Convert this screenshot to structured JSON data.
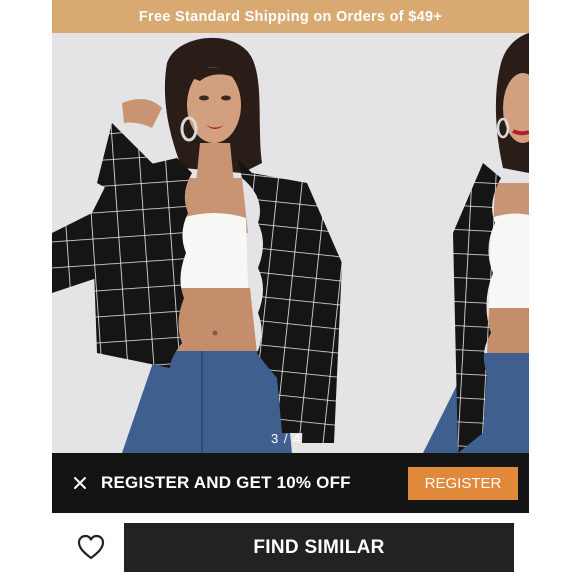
{
  "promo": {
    "text": "Free Standard Shipping on Orders of $49+"
  },
  "gallery": {
    "indicator": "3 / 4",
    "colors": {
      "backdrop": "#e4e4e6",
      "jacket": "#151515",
      "grid": "#f2f2f2",
      "denim": "#3f5f8f",
      "top": "#f7f7f5",
      "skin": "#c99473",
      "hair": "#2a1d18"
    }
  },
  "register_bar": {
    "close_icon": "close-icon",
    "text": "REGISTER AND GET 10% OFF",
    "button_label": "REGISTER",
    "accent": "#e0893b"
  },
  "bottom": {
    "wishlist_icon": "heart-outline-icon",
    "find_label": "FIND SIMILAR"
  }
}
